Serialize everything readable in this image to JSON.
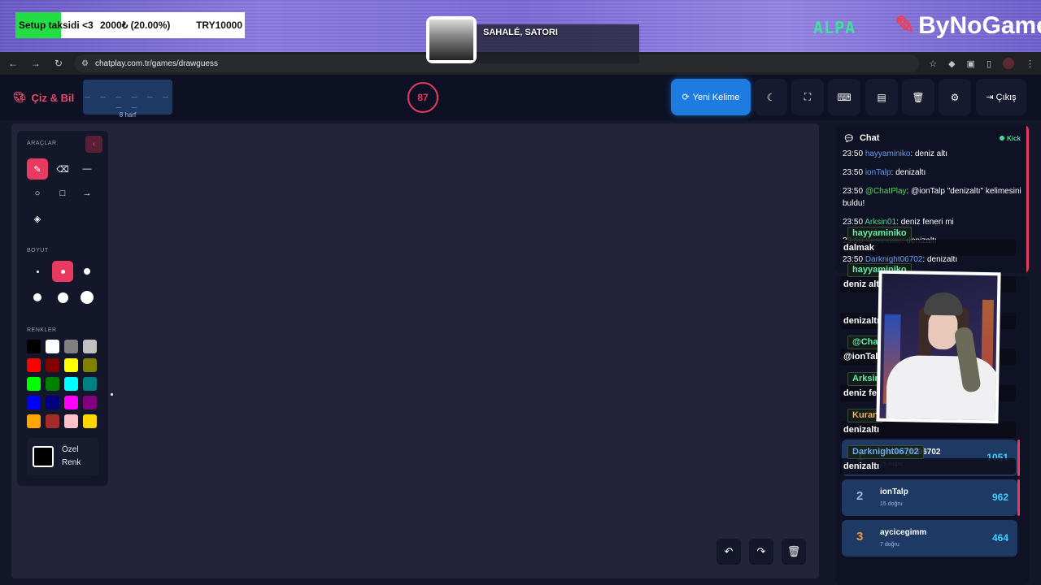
{
  "stream_overlay": {
    "donation": {
      "goal_label": "Setup taksidi <3",
      "amount": "2000₺ (20.00%)",
      "target": "TRY10000",
      "progress": 0.2,
      "fill_color": "#22dd44"
    },
    "music": {
      "title": "SAHALÉ, SATORI"
    },
    "alpa_logo": "ALPA",
    "brand_logo": "ByNoGame",
    "chat_overlay": [
      {
        "user": "hayyaminiko",
        "text": "dalmak",
        "color": "green"
      },
      {
        "user": "hayyaminiko",
        "text": "deniz altı",
        "color": "green"
      },
      {
        "user": "",
        "text": "denizaltı",
        "color": "blue"
      },
      {
        "user": "@Cha",
        "text": "@ionTal",
        "color": "green"
      },
      {
        "user": "Arksin",
        "text": "deniz fe",
        "color": "green"
      },
      {
        "user": "Kuran",
        "text": "denizaltı",
        "color": "orange"
      },
      {
        "user": "Darknight06702",
        "text": "denizaltı",
        "color": "blue"
      }
    ]
  },
  "browser": {
    "url": "chatplay.com.tr/games/drawguess"
  },
  "header": {
    "logo": "Çiz & Bil",
    "word_blanks": "_ _ _ _ _ _ _ _",
    "word_count": "8 harf",
    "timer": "87",
    "new_word_label": "Yeni Kelime",
    "exit_label": "Çıkış"
  },
  "tools": {
    "heading": "ARAÇLAR",
    "size_heading": "BOYUT",
    "colors_heading": "RENKLER",
    "custom_color_label": "Özel Renk",
    "colors": [
      "#000000",
      "#ffffff",
      "#808080",
      "#c0c0c0",
      "#ff0000",
      "#800000",
      "#ffff00",
      "#808000",
      "#00ff00",
      "#008000",
      "#00ffff",
      "#008080",
      "#0000ff",
      "#000080",
      "#ff00ff",
      "#800080",
      "#ffa500",
      "#a52a2a",
      "#ffc0cb",
      "#ffd700"
    ],
    "accent": "#e83a60"
  },
  "chat": {
    "title": "Chat",
    "source": "Kick",
    "messages": [
      {
        "time": "23:50",
        "user": "hayyaminiko",
        "text": ": deniz altı",
        "kind": "user"
      },
      {
        "time": "23:50",
        "user": "ionTalp",
        "text": ": denizaltı",
        "kind": "user"
      },
      {
        "time": "23:50",
        "user": "@ChatPlay",
        "text": ": @ionTalp \"denizaltı\" kelimesini buldu!",
        "kind": "cp"
      },
      {
        "time": "23:50",
        "user": "Arksin01",
        "text": ": deniz feneri mi",
        "kind": "green"
      },
      {
        "time": "23:50",
        "user": "Kurandaki",
        "text": ": denizaltı",
        "kind": "user"
      },
      {
        "time": "23:50",
        "user": "Darknight06702",
        "text": ": denizaltı",
        "kind": "user"
      }
    ]
  },
  "leaderboard": [
    {
      "rank": "1",
      "name": "Darknight06702",
      "sub": "15 doğru",
      "score": "1051"
    },
    {
      "rank": "2",
      "name": "ionTalp",
      "sub": "15 doğru",
      "score": "962"
    },
    {
      "rank": "3",
      "name": "aycicegimm",
      "sub": "7 doğru",
      "score": "464"
    }
  ]
}
